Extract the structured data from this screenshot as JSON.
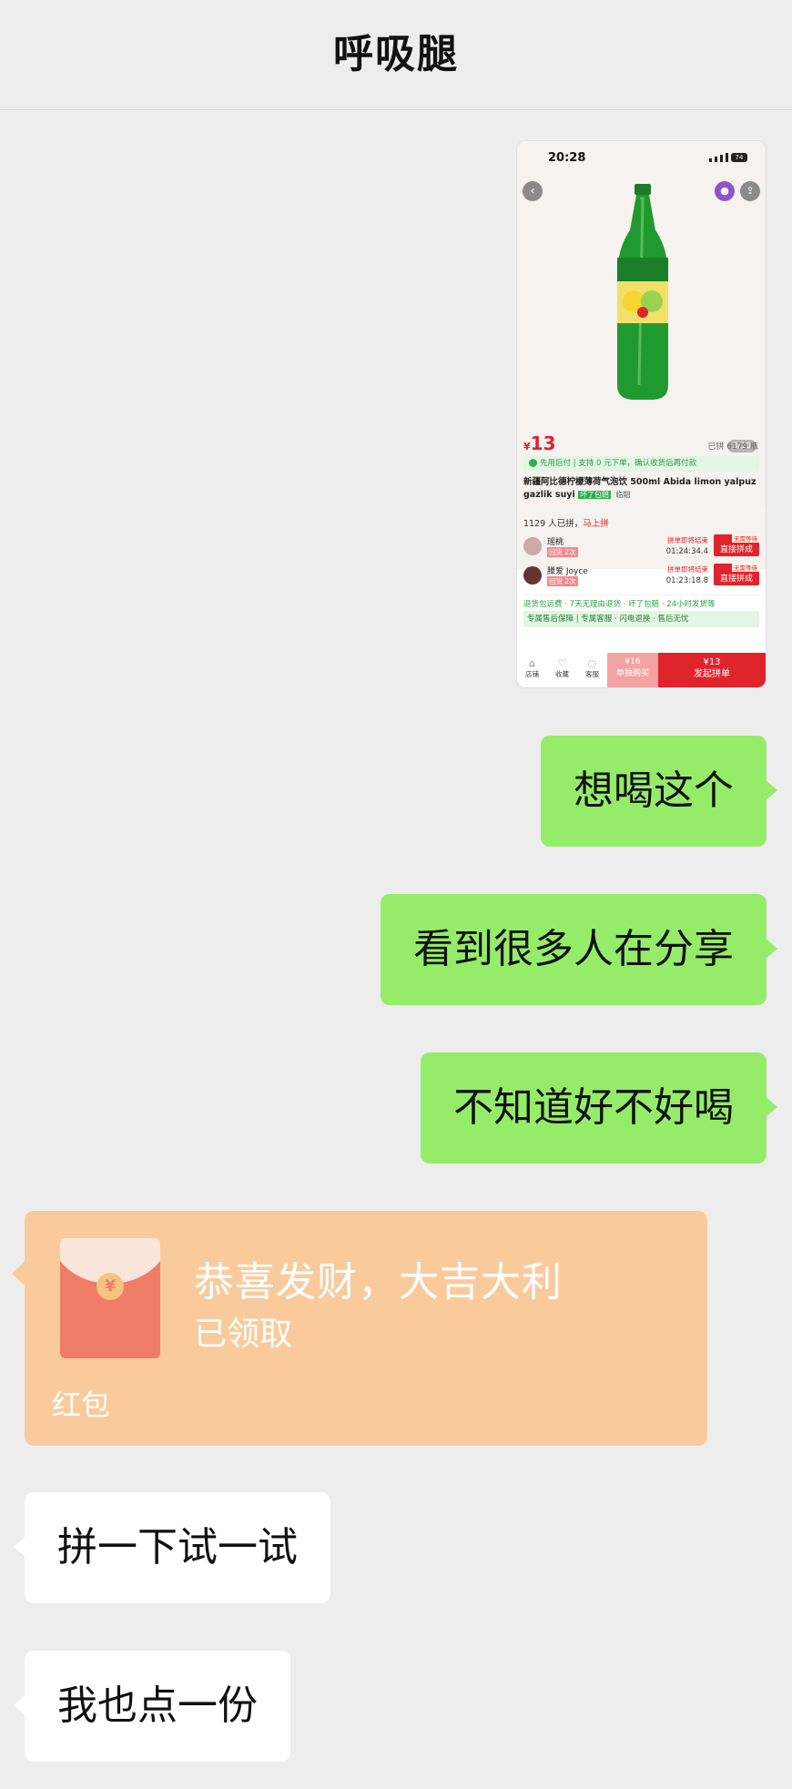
{
  "header": {
    "title": "呼吸腿"
  },
  "shared_screenshot": {
    "status_time": "20:28",
    "battery": "74",
    "pager": "3/10",
    "price": "13",
    "currency": "¥",
    "sold": "已拼 6179 瓶",
    "pay_later": "先用后付 | 支持 0 元下单，确认收货后再付款",
    "product_title": "新疆阿比德柠檬薄荷气泡饮 500ml Abida limon yalpuz gazlik suyi",
    "tag_bad_refund": "坏了包赔",
    "tag_expiry": "临期",
    "joined_count": "1129 人已拼，",
    "join_now": "马上拼",
    "groups": [
      {
        "name": "瑶桃",
        "repeat": "回货 2次",
        "ending": "拼单即将结束",
        "countdown": "01:24:34.4",
        "tip": "无需等待",
        "join": "直接拼成"
      },
      {
        "name": "滕爱 Joyce",
        "repeat": "回货 2次",
        "ending": "拼单即将结束",
        "countdown": "01:23:18.8",
        "tip": "无需等待",
        "join": "直接拼成"
      }
    ],
    "service_line": "退货包运费 · 7天无理由退货 · 坏了包赔 · 24小时发货等",
    "guarantee_line": "专属售后保障 | 专属客服 · 闪电退换 · 售后无忧",
    "bottom": {
      "store": "店铺",
      "fav": "收藏",
      "service": "客服",
      "solo_price": "¥16",
      "solo_label": "单独购买",
      "group_price": "¥13",
      "group_label": "发起拼单"
    }
  },
  "messages": [
    {
      "side": "right",
      "text": "想喝这个"
    },
    {
      "side": "right",
      "text": "看到很多人在分享"
    },
    {
      "side": "right",
      "text": "不知道好不好喝"
    },
    {
      "side": "left",
      "text": "拼一下试一试"
    },
    {
      "side": "left",
      "text": "我也点一份"
    }
  ],
  "red_envelope": {
    "title": "恭喜发财，大吉大利",
    "status": "已领取",
    "label": "红包",
    "coin": "¥"
  },
  "colors": {
    "my_bubble": "#95ec69",
    "their_bubble": "#ffffff",
    "envelope": "#f9cb9c",
    "background": "#ededed"
  }
}
